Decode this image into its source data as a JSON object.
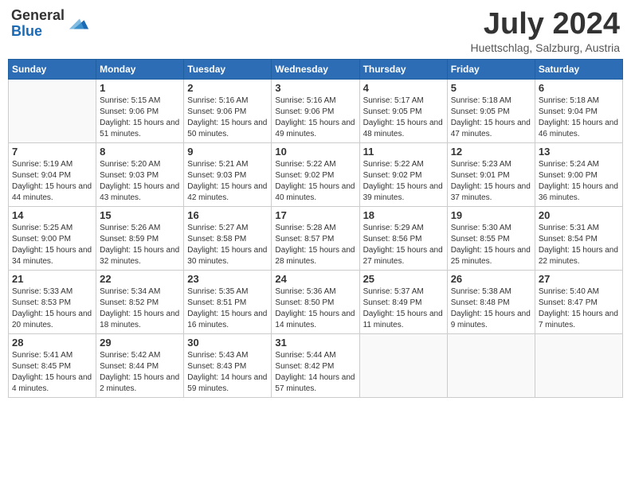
{
  "logo": {
    "general": "General",
    "blue": "Blue"
  },
  "title": {
    "month_year": "July 2024",
    "location": "Huettschlag, Salzburg, Austria"
  },
  "headers": [
    "Sunday",
    "Monday",
    "Tuesday",
    "Wednesday",
    "Thursday",
    "Friday",
    "Saturday"
  ],
  "weeks": [
    [
      {
        "day": "",
        "sunrise": "",
        "sunset": "",
        "daylight": ""
      },
      {
        "day": "1",
        "sunrise": "Sunrise: 5:15 AM",
        "sunset": "Sunset: 9:06 PM",
        "daylight": "Daylight: 15 hours and 51 minutes."
      },
      {
        "day": "2",
        "sunrise": "Sunrise: 5:16 AM",
        "sunset": "Sunset: 9:06 PM",
        "daylight": "Daylight: 15 hours and 50 minutes."
      },
      {
        "day": "3",
        "sunrise": "Sunrise: 5:16 AM",
        "sunset": "Sunset: 9:06 PM",
        "daylight": "Daylight: 15 hours and 49 minutes."
      },
      {
        "day": "4",
        "sunrise": "Sunrise: 5:17 AM",
        "sunset": "Sunset: 9:05 PM",
        "daylight": "Daylight: 15 hours and 48 minutes."
      },
      {
        "day": "5",
        "sunrise": "Sunrise: 5:18 AM",
        "sunset": "Sunset: 9:05 PM",
        "daylight": "Daylight: 15 hours and 47 minutes."
      },
      {
        "day": "6",
        "sunrise": "Sunrise: 5:18 AM",
        "sunset": "Sunset: 9:04 PM",
        "daylight": "Daylight: 15 hours and 46 minutes."
      }
    ],
    [
      {
        "day": "7",
        "sunrise": "Sunrise: 5:19 AM",
        "sunset": "Sunset: 9:04 PM",
        "daylight": "Daylight: 15 hours and 44 minutes."
      },
      {
        "day": "8",
        "sunrise": "Sunrise: 5:20 AM",
        "sunset": "Sunset: 9:03 PM",
        "daylight": "Daylight: 15 hours and 43 minutes."
      },
      {
        "day": "9",
        "sunrise": "Sunrise: 5:21 AM",
        "sunset": "Sunset: 9:03 PM",
        "daylight": "Daylight: 15 hours and 42 minutes."
      },
      {
        "day": "10",
        "sunrise": "Sunrise: 5:22 AM",
        "sunset": "Sunset: 9:02 PM",
        "daylight": "Daylight: 15 hours and 40 minutes."
      },
      {
        "day": "11",
        "sunrise": "Sunrise: 5:22 AM",
        "sunset": "Sunset: 9:02 PM",
        "daylight": "Daylight: 15 hours and 39 minutes."
      },
      {
        "day": "12",
        "sunrise": "Sunrise: 5:23 AM",
        "sunset": "Sunset: 9:01 PM",
        "daylight": "Daylight: 15 hours and 37 minutes."
      },
      {
        "day": "13",
        "sunrise": "Sunrise: 5:24 AM",
        "sunset": "Sunset: 9:00 PM",
        "daylight": "Daylight: 15 hours and 36 minutes."
      }
    ],
    [
      {
        "day": "14",
        "sunrise": "Sunrise: 5:25 AM",
        "sunset": "Sunset: 9:00 PM",
        "daylight": "Daylight: 15 hours and 34 minutes."
      },
      {
        "day": "15",
        "sunrise": "Sunrise: 5:26 AM",
        "sunset": "Sunset: 8:59 PM",
        "daylight": "Daylight: 15 hours and 32 minutes."
      },
      {
        "day": "16",
        "sunrise": "Sunrise: 5:27 AM",
        "sunset": "Sunset: 8:58 PM",
        "daylight": "Daylight: 15 hours and 30 minutes."
      },
      {
        "day": "17",
        "sunrise": "Sunrise: 5:28 AM",
        "sunset": "Sunset: 8:57 PM",
        "daylight": "Daylight: 15 hours and 28 minutes."
      },
      {
        "day": "18",
        "sunrise": "Sunrise: 5:29 AM",
        "sunset": "Sunset: 8:56 PM",
        "daylight": "Daylight: 15 hours and 27 minutes."
      },
      {
        "day": "19",
        "sunrise": "Sunrise: 5:30 AM",
        "sunset": "Sunset: 8:55 PM",
        "daylight": "Daylight: 15 hours and 25 minutes."
      },
      {
        "day": "20",
        "sunrise": "Sunrise: 5:31 AM",
        "sunset": "Sunset: 8:54 PM",
        "daylight": "Daylight: 15 hours and 22 minutes."
      }
    ],
    [
      {
        "day": "21",
        "sunrise": "Sunrise: 5:33 AM",
        "sunset": "Sunset: 8:53 PM",
        "daylight": "Daylight: 15 hours and 20 minutes."
      },
      {
        "day": "22",
        "sunrise": "Sunrise: 5:34 AM",
        "sunset": "Sunset: 8:52 PM",
        "daylight": "Daylight: 15 hours and 18 minutes."
      },
      {
        "day": "23",
        "sunrise": "Sunrise: 5:35 AM",
        "sunset": "Sunset: 8:51 PM",
        "daylight": "Daylight: 15 hours and 16 minutes."
      },
      {
        "day": "24",
        "sunrise": "Sunrise: 5:36 AM",
        "sunset": "Sunset: 8:50 PM",
        "daylight": "Daylight: 15 hours and 14 minutes."
      },
      {
        "day": "25",
        "sunrise": "Sunrise: 5:37 AM",
        "sunset": "Sunset: 8:49 PM",
        "daylight": "Daylight: 15 hours and 11 minutes."
      },
      {
        "day": "26",
        "sunrise": "Sunrise: 5:38 AM",
        "sunset": "Sunset: 8:48 PM",
        "daylight": "Daylight: 15 hours and 9 minutes."
      },
      {
        "day": "27",
        "sunrise": "Sunrise: 5:40 AM",
        "sunset": "Sunset: 8:47 PM",
        "daylight": "Daylight: 15 hours and 7 minutes."
      }
    ],
    [
      {
        "day": "28",
        "sunrise": "Sunrise: 5:41 AM",
        "sunset": "Sunset: 8:45 PM",
        "daylight": "Daylight: 15 hours and 4 minutes."
      },
      {
        "day": "29",
        "sunrise": "Sunrise: 5:42 AM",
        "sunset": "Sunset: 8:44 PM",
        "daylight": "Daylight: 15 hours and 2 minutes."
      },
      {
        "day": "30",
        "sunrise": "Sunrise: 5:43 AM",
        "sunset": "Sunset: 8:43 PM",
        "daylight": "Daylight: 14 hours and 59 minutes."
      },
      {
        "day": "31",
        "sunrise": "Sunrise: 5:44 AM",
        "sunset": "Sunset: 8:42 PM",
        "daylight": "Daylight: 14 hours and 57 minutes."
      },
      {
        "day": "",
        "sunrise": "",
        "sunset": "",
        "daylight": ""
      },
      {
        "day": "",
        "sunrise": "",
        "sunset": "",
        "daylight": ""
      },
      {
        "day": "",
        "sunrise": "",
        "sunset": "",
        "daylight": ""
      }
    ]
  ]
}
